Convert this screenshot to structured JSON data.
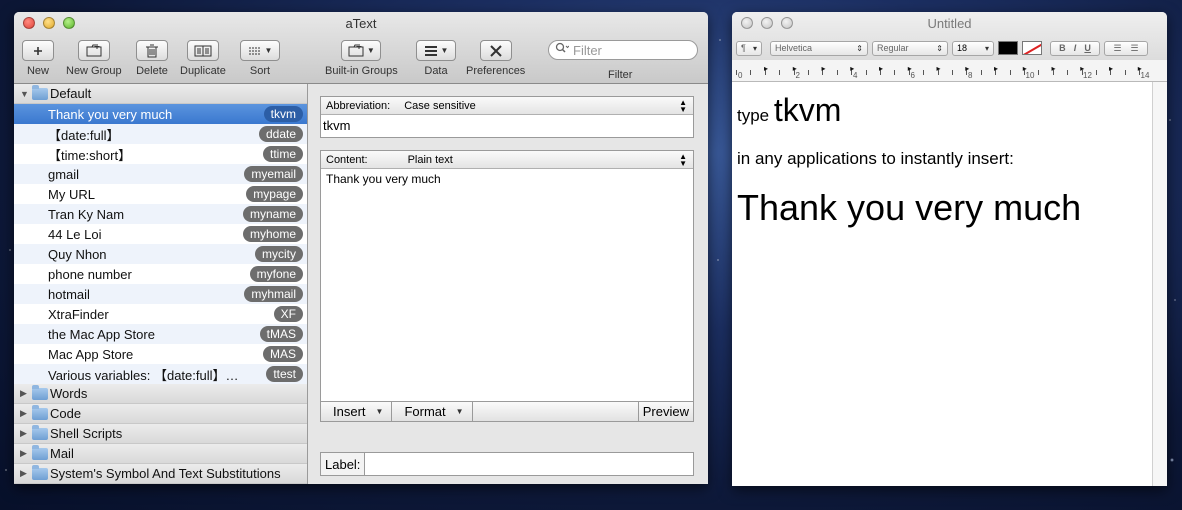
{
  "atext": {
    "title": "aText",
    "toolbar": {
      "new": "New",
      "new_group": "New Group",
      "delete": "Delete",
      "duplicate": "Duplicate",
      "sort": "Sort",
      "builtin_groups": "Built-in Groups",
      "data": "Data",
      "preferences": "Preferences",
      "filter_label": "Filter",
      "filter_placeholder": "Filter"
    },
    "sidebar": {
      "default_group": "Default",
      "items": [
        {
          "name": "Thank you very much",
          "abbr": "tkvm"
        },
        {
          "name": "【date:full】",
          "abbr": "ddate"
        },
        {
          "name": "【time:short】",
          "abbr": "ttime"
        },
        {
          "name": "gmail",
          "abbr": "myemail"
        },
        {
          "name": "My URL",
          "abbr": "mypage"
        },
        {
          "name": "Tran Ky Nam",
          "abbr": "myname"
        },
        {
          "name": "44 Le Loi",
          "abbr": "myhome"
        },
        {
          "name": "Quy Nhon",
          "abbr": "mycity"
        },
        {
          "name": "phone number",
          "abbr": "myfone"
        },
        {
          "name": "hotmail",
          "abbr": "myhmail"
        },
        {
          "name": "XtraFinder",
          "abbr": "XF"
        },
        {
          "name": "the Mac App Store",
          "abbr": "tMAS"
        },
        {
          "name": "Mac App Store",
          "abbr": "MAS"
        },
        {
          "name": "Various variables: 【date:full】…",
          "abbr": "ttest"
        }
      ],
      "groups": [
        "Words",
        "Code",
        "Shell Scripts",
        "Mail",
        "System's Symbol And Text Substitutions"
      ]
    },
    "editor": {
      "abbreviation_label": "Abbreviation:",
      "abbreviation_mode": "Case sensitive",
      "abbreviation_value": "tkvm",
      "content_label": "Content:",
      "content_mode": "Plain text",
      "content_value": "Thank you very much",
      "insert": "Insert",
      "format": "Format",
      "preview": "Preview",
      "label_label": "Label:"
    }
  },
  "textedit": {
    "title": "Untitled",
    "paragraph_menu": "¶",
    "font_family": "Helvetica",
    "font_style": "Regular",
    "font_size": "18",
    "bold": "B",
    "italic": "I",
    "underline": "U",
    "ruler_numbers": [
      "0",
      "2",
      "4",
      "6",
      "8",
      "10",
      "12",
      "14"
    ],
    "doc": {
      "type_word": "type",
      "abbr": "tkvm",
      "line2": "in any applications to instantly insert:",
      "line3": "Thank you very much"
    }
  }
}
